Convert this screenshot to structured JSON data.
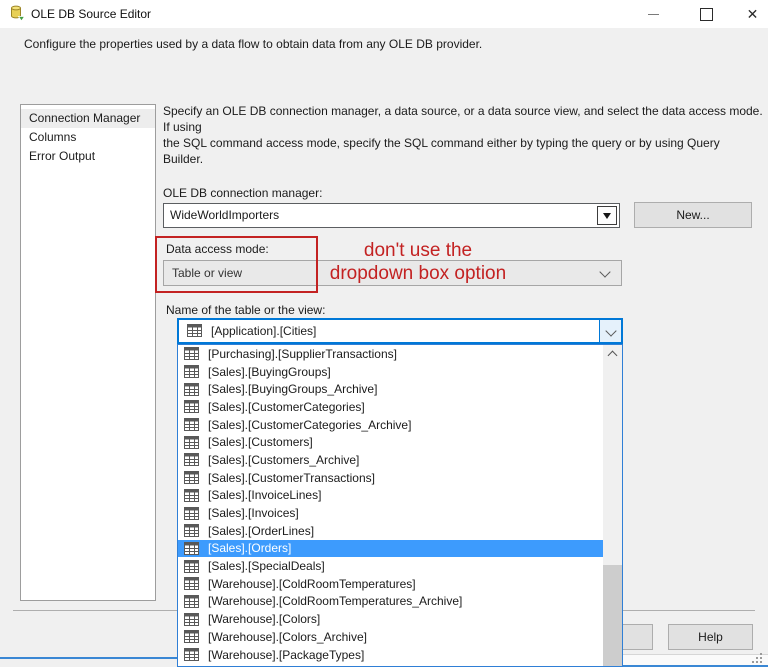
{
  "window": {
    "title": "OLE DB Source Editor",
    "controls": {
      "minimize": "minimize",
      "maximize": "maximize",
      "close": "close"
    }
  },
  "header": {
    "description": "Configure the properties used by a data flow to obtain data from any OLE DB provider."
  },
  "sidebar": {
    "items": [
      {
        "label": "Connection Manager",
        "selected": true
      },
      {
        "label": "Columns",
        "selected": false
      },
      {
        "label": "Error Output",
        "selected": false
      }
    ]
  },
  "main": {
    "instructions": {
      "line1": "Specify an OLE DB connection manager, a data source, or a data source view, and select the data access mode. If using",
      "line2": "the SQL command access mode, specify the SQL command either by typing the query or by using Query Builder."
    },
    "connection_manager": {
      "label": "OLE DB connection manager:",
      "value": "WideWorldImporters",
      "new_button": "New..."
    },
    "data_access_mode": {
      "label": "Data access mode:",
      "value": "Table or view"
    },
    "annotation": {
      "line1": "don't use the",
      "line2": "dropdown box option",
      "color": "#c32222"
    },
    "table_name": {
      "label": "Name of the table or the view:",
      "value": "[Application].[Cities]"
    },
    "dropdown": {
      "selected_index": 11,
      "items": [
        "[Purchasing].[SupplierTransactions]",
        "[Sales].[BuyingGroups]",
        "[Sales].[BuyingGroups_Archive]",
        "[Sales].[CustomerCategories]",
        "[Sales].[CustomerCategories_Archive]",
        "[Sales].[Customers]",
        "[Sales].[Customers_Archive]",
        "[Sales].[CustomerTransactions]",
        "[Sales].[InvoiceLines]",
        "[Sales].[Invoices]",
        "[Sales].[OrderLines]",
        "[Sales].[Orders]",
        "[Sales].[SpecialDeals]",
        "[Warehouse].[ColdRoomTemperatures]",
        "[Warehouse].[ColdRoomTemperatures_Archive]",
        "[Warehouse].[Colors]",
        "[Warehouse].[Colors_Archive]",
        "[Warehouse].[PackageTypes]"
      ]
    }
  },
  "footer": {
    "help_label": "Help"
  },
  "colors": {
    "selection_blue": "#3d9bfd",
    "focus_border": "#0078d7",
    "annotation_red": "#c32222"
  }
}
